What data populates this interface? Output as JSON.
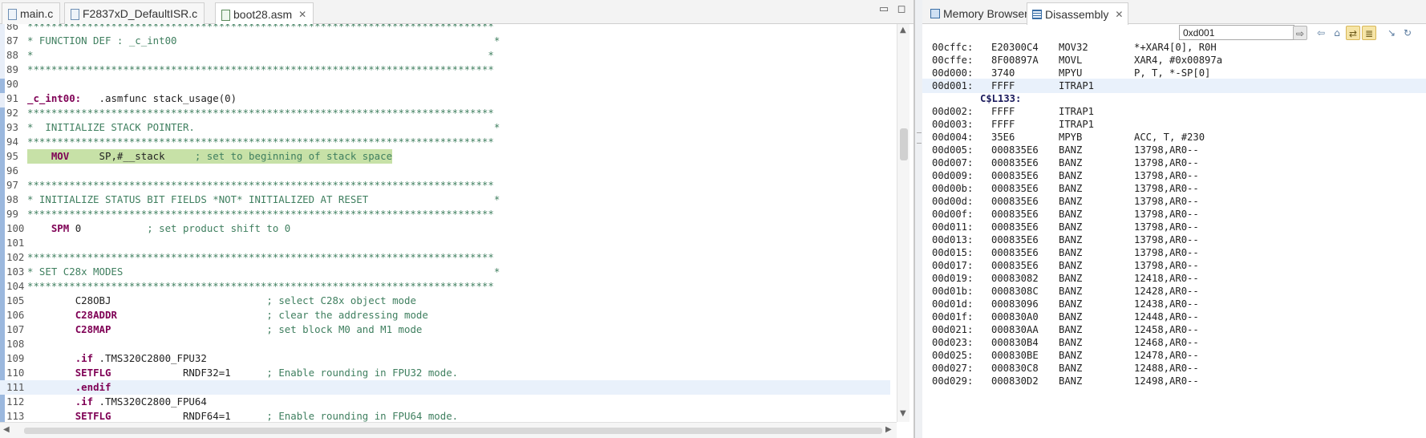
{
  "editor": {
    "tabs": [
      {
        "label": "main.c",
        "active": false
      },
      {
        "label": "F2837xD_DefaultISR.c",
        "active": false
      },
      {
        "label": "boot28.asm",
        "active": true
      }
    ],
    "close_glyph": "✕",
    "minimize_glyph": "▭",
    "maximize_glyph": "◻",
    "lines": [
      {
        "n": "86",
        "kind": "comment",
        "text": "******************************************************************************"
      },
      {
        "n": "87",
        "kind": "comment",
        "text": "* FUNCTION DEF : _c_int00                                                     *"
      },
      {
        "n": "88",
        "kind": "comment",
        "text": "*                                                                            *"
      },
      {
        "n": "89",
        "kind": "comment",
        "text": "******************************************************************************"
      },
      {
        "n": "90",
        "kind": "blank",
        "text": ""
      },
      {
        "n": "91",
        "kind": "label",
        "label": "_c_int00:",
        "rest": "   .asmfunc stack_usage(0)"
      },
      {
        "n": "92",
        "kind": "comment",
        "text": "******************************************************************************"
      },
      {
        "n": "93",
        "kind": "comment",
        "text": "*  INITIALIZE STACK POINTER.                                                  *"
      },
      {
        "n": "94",
        "kind": "comment",
        "text": "******************************************************************************"
      },
      {
        "n": "95",
        "kind": "instr",
        "hl": "green",
        "indent": "    ",
        "mn": "MOV",
        "args": "     SP,#__stack     ",
        "cm": "; set to beginning of stack space"
      },
      {
        "n": "96",
        "kind": "blank",
        "text": ""
      },
      {
        "n": "97",
        "kind": "comment",
        "text": "******************************************************************************"
      },
      {
        "n": "98",
        "kind": "comment",
        "text": "* INITIALIZE STATUS BIT FIELDS *NOT* INITIALIZED AT RESET                     *"
      },
      {
        "n": "99",
        "kind": "comment",
        "text": "******************************************************************************"
      },
      {
        "n": "100",
        "kind": "instr",
        "indent": "    ",
        "mn": "SPM",
        "args": " 0           ",
        "cm": "; set product shift to 0"
      },
      {
        "n": "101",
        "kind": "blank",
        "text": ""
      },
      {
        "n": "102",
        "kind": "comment",
        "text": "******************************************************************************"
      },
      {
        "n": "103",
        "kind": "comment",
        "text": "* SET C28x MODES                                                              *"
      },
      {
        "n": "104",
        "kind": "comment",
        "text": "******************************************************************************"
      },
      {
        "n": "105",
        "kind": "instr",
        "indent": "        ",
        "mn": "C28OBJ",
        "mnstyle": "plain",
        "args": "                          ",
        "cm": "; select C28x object mode"
      },
      {
        "n": "106",
        "kind": "instr",
        "indent": "        ",
        "mn": "C28ADDR",
        "args": "                         ",
        "cm": "; clear the addressing mode"
      },
      {
        "n": "107",
        "kind": "instr",
        "indent": "        ",
        "mn": "C28MAP",
        "args": "                          ",
        "cm": "; set block M0 and M1 mode"
      },
      {
        "n": "108",
        "kind": "blank",
        "text": ""
      },
      {
        "n": "109",
        "kind": "instr",
        "indent": "        ",
        "mn": ".if",
        "args": " .TMS320C2800_FPU32",
        "cm": ""
      },
      {
        "n": "110",
        "kind": "instr",
        "indent": "        ",
        "mn": "SETFLG",
        "args": "            RNDF32=1      ",
        "cm": "; Enable rounding in FPU32 mode."
      },
      {
        "n": "111",
        "kind": "instr",
        "hl": "cur",
        "indent": "        ",
        "mn": ".endif",
        "args": "",
        "cm": ""
      },
      {
        "n": "112",
        "kind": "instr",
        "indent": "        ",
        "mn": ".if",
        "args": " .TMS320C2800_FPU64",
        "cm": ""
      },
      {
        "n": "113",
        "kind": "instr",
        "indent": "        ",
        "mn": "SETFLG",
        "args": "            RNDF64=1      ",
        "cm": "; Enable rounding in FPU64 mode."
      }
    ]
  },
  "disassembly": {
    "tabs": [
      {
        "label": "Memory Browser",
        "active": false
      },
      {
        "label": "Disassembly",
        "active": true
      }
    ],
    "address_input": "0xd001",
    "rows": [
      {
        "addr": "00cffc:",
        "op": "E20300C4",
        "mn": "MOV32",
        "args": "*+XAR4[0], R0H"
      },
      {
        "addr": "00cffe:",
        "op": "8F00897A",
        "mn": "MOVL",
        "args": "XAR4, #0x00897a"
      },
      {
        "addr": "00d000:",
        "op": "3740",
        "mn": "MPYU",
        "args": "P, T, *-SP[0]"
      },
      {
        "addr": "00d001:",
        "op": "FFFF",
        "mn": "ITRAP1",
        "args": "",
        "current": true
      },
      {
        "label": "C$L133:"
      },
      {
        "addr": "00d002:",
        "op": "FFFF",
        "mn": "ITRAP1",
        "args": ""
      },
      {
        "addr": "00d003:",
        "op": "FFFF",
        "mn": "ITRAP1",
        "args": ""
      },
      {
        "addr": "00d004:",
        "op": "35E6",
        "mn": "MPYB",
        "args": "ACC, T, #230"
      },
      {
        "addr": "00d005:",
        "op": "000835E6",
        "mn": "BANZ",
        "args": "13798,AR0--"
      },
      {
        "addr": "00d007:",
        "op": "000835E6",
        "mn": "BANZ",
        "args": "13798,AR0--"
      },
      {
        "addr": "00d009:",
        "op": "000835E6",
        "mn": "BANZ",
        "args": "13798,AR0--"
      },
      {
        "addr": "00d00b:",
        "op": "000835E6",
        "mn": "BANZ",
        "args": "13798,AR0--"
      },
      {
        "addr": "00d00d:",
        "op": "000835E6",
        "mn": "BANZ",
        "args": "13798,AR0--"
      },
      {
        "addr": "00d00f:",
        "op": "000835E6",
        "mn": "BANZ",
        "args": "13798,AR0--"
      },
      {
        "addr": "00d011:",
        "op": "000835E6",
        "mn": "BANZ",
        "args": "13798,AR0--"
      },
      {
        "addr": "00d013:",
        "op": "000835E6",
        "mn": "BANZ",
        "args": "13798,AR0--"
      },
      {
        "addr": "00d015:",
        "op": "000835E6",
        "mn": "BANZ",
        "args": "13798,AR0--"
      },
      {
        "addr": "00d017:",
        "op": "000835E6",
        "mn": "BANZ",
        "args": "13798,AR0--"
      },
      {
        "addr": "00d019:",
        "op": "00083082",
        "mn": "BANZ",
        "args": "12418,AR0--"
      },
      {
        "addr": "00d01b:",
        "op": "0008308C",
        "mn": "BANZ",
        "args": "12428,AR0--"
      },
      {
        "addr": "00d01d:",
        "op": "00083096",
        "mn": "BANZ",
        "args": "12438,AR0--"
      },
      {
        "addr": "00d01f:",
        "op": "000830A0",
        "mn": "BANZ",
        "args": "12448,AR0--"
      },
      {
        "addr": "00d021:",
        "op": "000830AA",
        "mn": "BANZ",
        "args": "12458,AR0--"
      },
      {
        "addr": "00d023:",
        "op": "000830B4",
        "mn": "BANZ",
        "args": "12468,AR0--"
      },
      {
        "addr": "00d025:",
        "op": "000830BE",
        "mn": "BANZ",
        "args": "12478,AR0--"
      },
      {
        "addr": "00d027:",
        "op": "000830C8",
        "mn": "BANZ",
        "args": "12488,AR0--"
      },
      {
        "addr": "00d029:",
        "op": "000830D2",
        "mn": "BANZ",
        "args": "12498,AR0--"
      }
    ]
  },
  "colors": {
    "comment": "#3f7f5f",
    "keyword": "#7f0055",
    "highlight_green": "#c7e1a7",
    "current_line": "#e9f1fb"
  }
}
